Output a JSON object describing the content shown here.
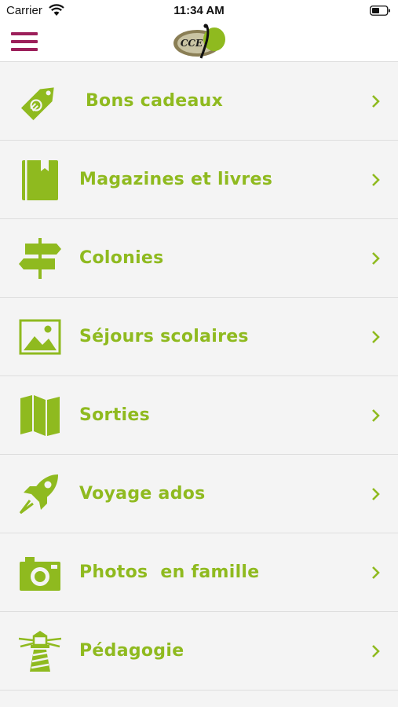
{
  "status_bar": {
    "carrier": "Carrier",
    "time": "11:34 AM"
  },
  "header": {
    "logo_text": "CCE"
  },
  "colors": {
    "accent": "#8fba1f",
    "menu": "#9c1f5a",
    "background": "#f4f4f4"
  },
  "menu_items": [
    {
      "label": " Bons cadeaux",
      "icon": "gift-tag-icon"
    },
    {
      "label": "Magazines et livres",
      "icon": "book-icon"
    },
    {
      "label": "Colonies",
      "icon": "signpost-icon"
    },
    {
      "label": "Séjours scolaires",
      "icon": "landscape-picture-icon"
    },
    {
      "label": "Sorties",
      "icon": "map-icon"
    },
    {
      "label": "Voyage ados",
      "icon": "rocket-icon"
    },
    {
      "label": "Photos  en famille",
      "icon": "camera-icon"
    },
    {
      "label": "Pédagogie",
      "icon": "lighthouse-icon"
    }
  ]
}
